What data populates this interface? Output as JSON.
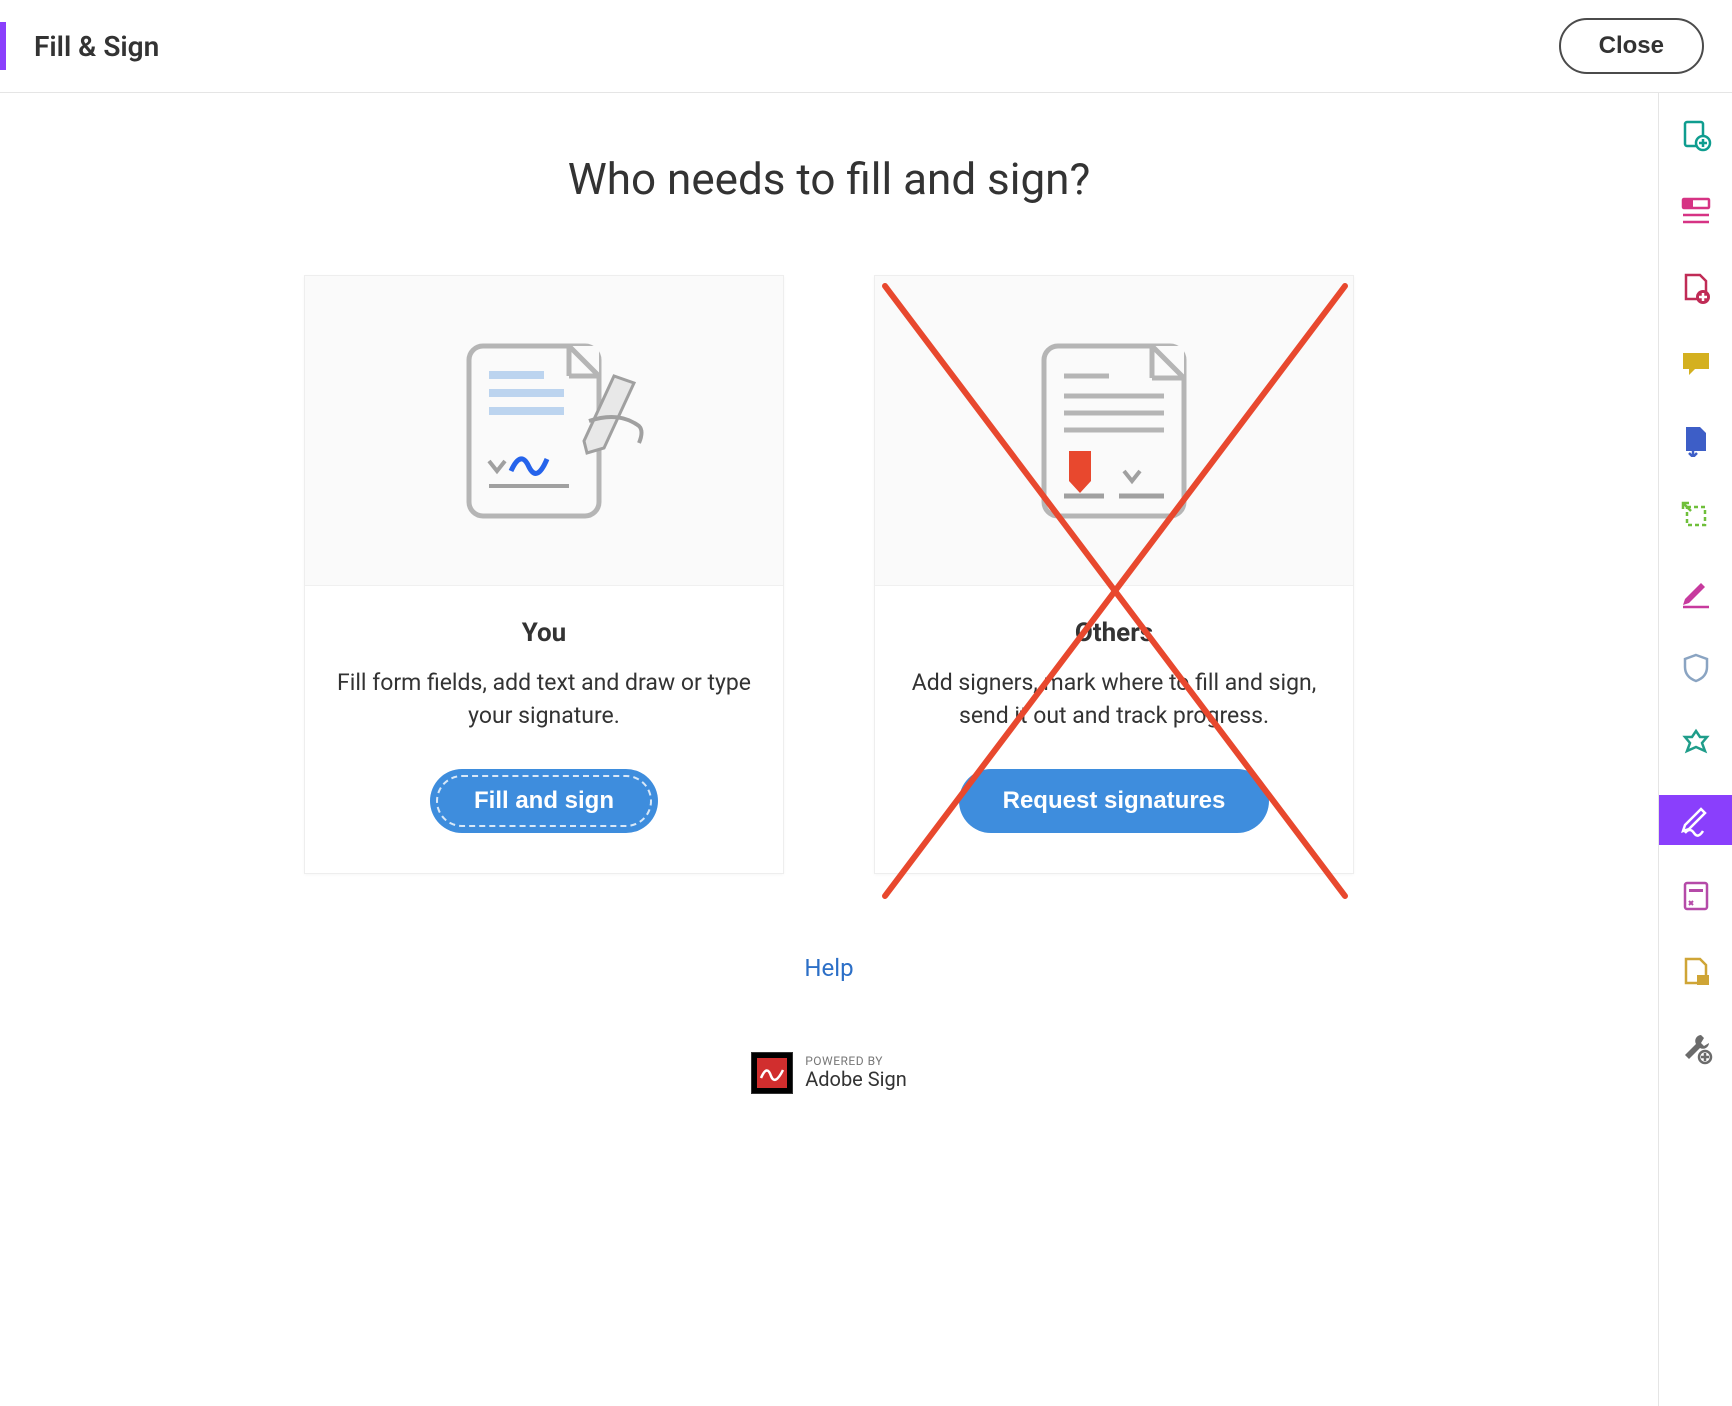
{
  "header": {
    "title": "Fill & Sign",
    "close_label": "Close"
  },
  "main": {
    "page_title": "Who needs to fill and sign?",
    "help_label": "Help"
  },
  "cards": [
    {
      "title": "You",
      "desc": "Fill form fields, add text and draw or type your signature.",
      "action_label": "Fill and sign"
    },
    {
      "title": "Others",
      "desc": "Add signers, mark where to fill and sign, send it out and track progress.",
      "action_label": "Request signatures"
    }
  ],
  "footer": {
    "powered_by": "POWERED BY",
    "brand": "Adobe Sign"
  },
  "sidebar": {
    "items": [
      {
        "name": "export-pdf-icon",
        "color": "#0f9d8f"
      },
      {
        "name": "organize-pages-icon",
        "color": "#d63384"
      },
      {
        "name": "create-pdf-icon",
        "color": "#c02b56"
      },
      {
        "name": "comment-icon",
        "color": "#d4b01f"
      },
      {
        "name": "send-file-icon",
        "color": "#3d5ec7"
      },
      {
        "name": "crop-icon",
        "color": "#6fbf3a"
      },
      {
        "name": "sign-icon",
        "color": "#c73a9e"
      },
      {
        "name": "protect-icon",
        "color": "#8aa4c2"
      },
      {
        "name": "stamp-icon",
        "color": "#1f9d8a"
      },
      {
        "name": "fill-sign-icon",
        "color": "#ffffff",
        "active": true
      },
      {
        "name": "redact-icon",
        "color": "#b54aa8"
      },
      {
        "name": "compare-icon",
        "color": "#cfa536"
      },
      {
        "name": "tools-icon",
        "color": "#6b6b6b"
      }
    ]
  },
  "colors": {
    "accent": "#8a3ffc",
    "button": "#3e8ddd",
    "cross": "#e8482e"
  }
}
